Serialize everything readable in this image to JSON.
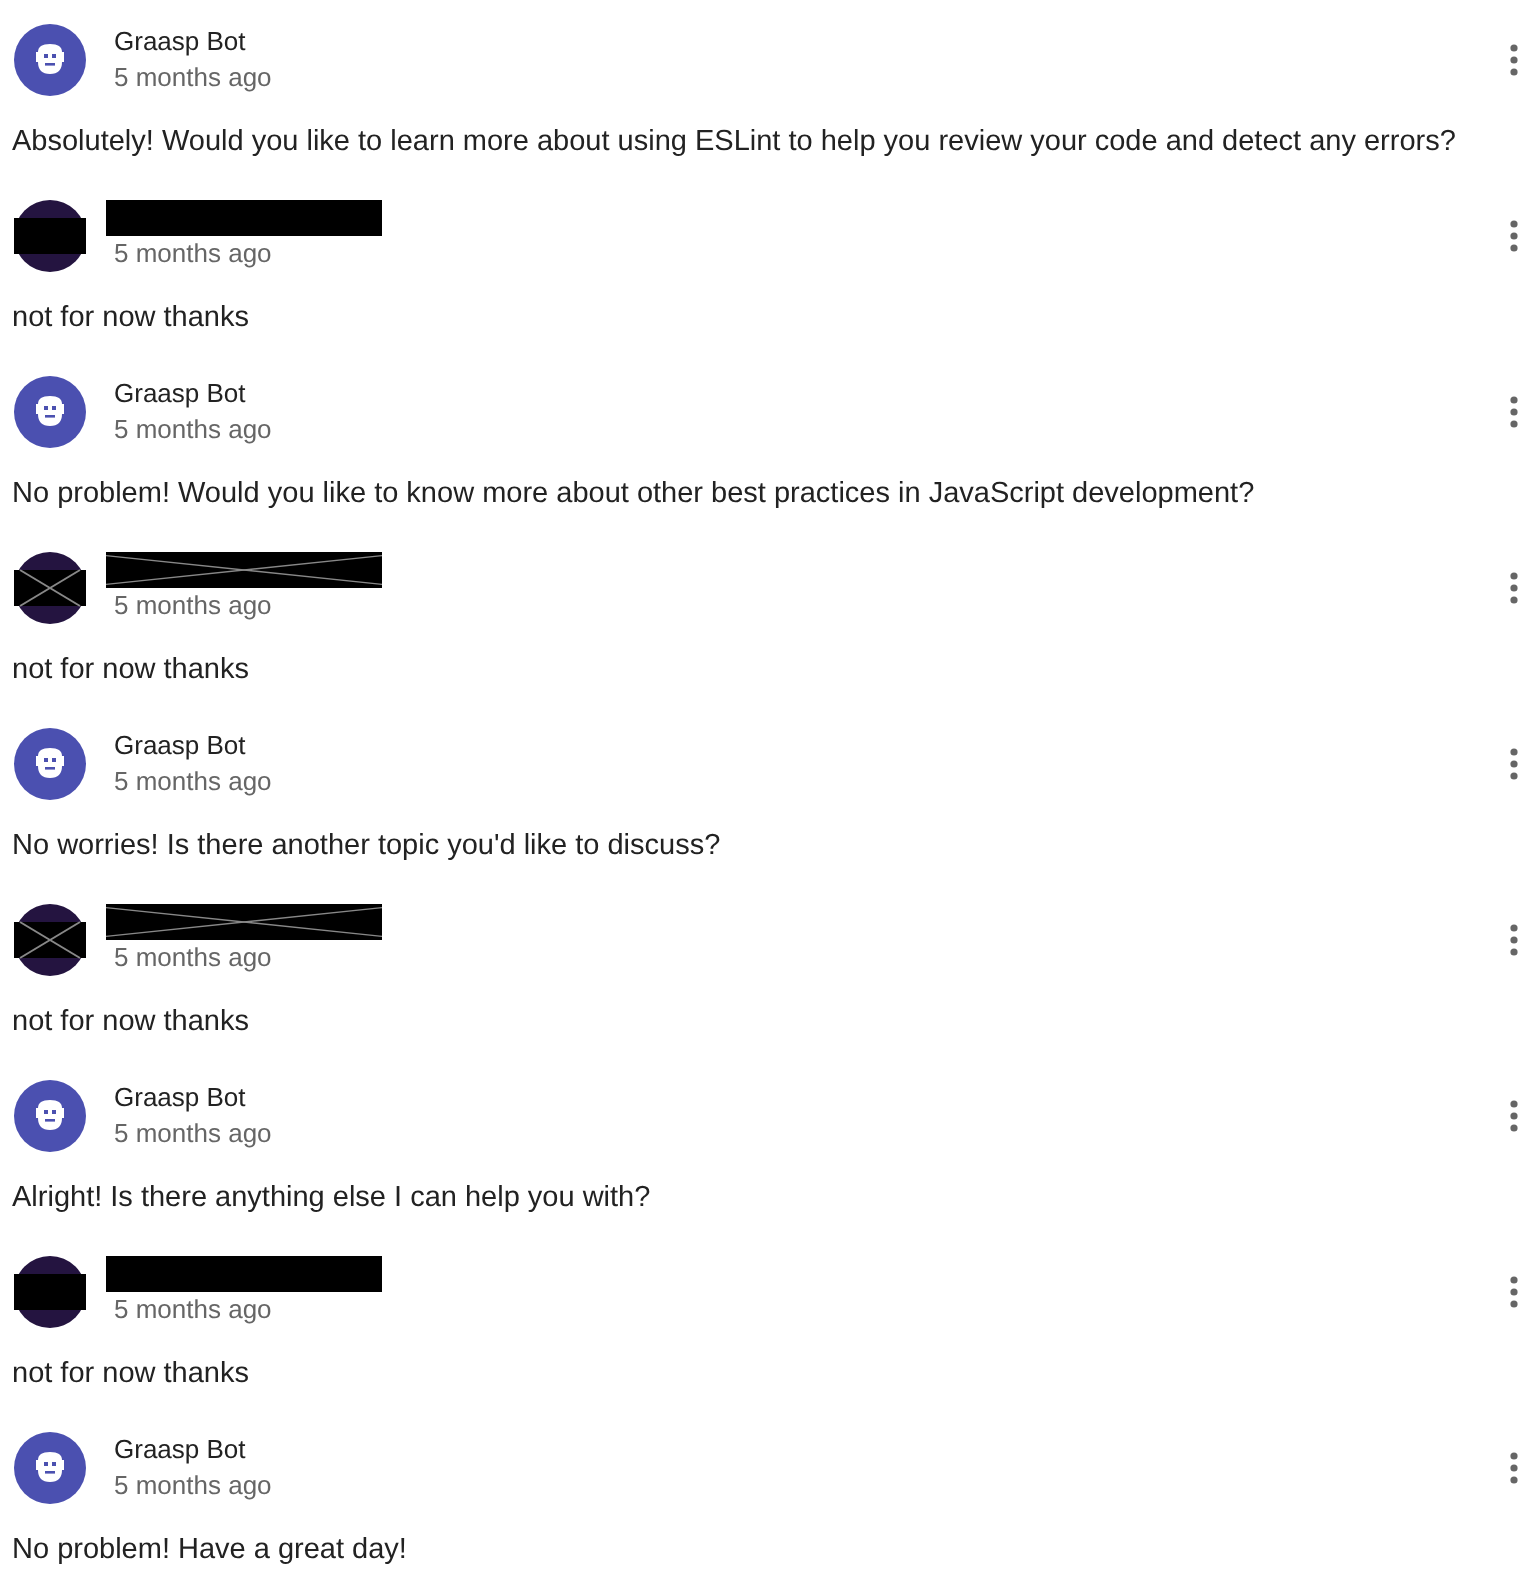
{
  "messages": [
    {
      "kind": "bot",
      "author": "Graasp Bot",
      "time": "5 months ago",
      "text": "Absolutely! Would you like to learn more about using ESLint to help you review your code and detect any errors?"
    },
    {
      "kind": "user",
      "crossed": false,
      "time": "5 months ago",
      "text": "not for now thanks"
    },
    {
      "kind": "bot",
      "author": "Graasp Bot",
      "time": "5 months ago",
      "text": "No problem! Would you like to know more about other best practices in JavaScript development?"
    },
    {
      "kind": "user",
      "crossed": true,
      "time": "5 months ago",
      "text": "not for now thanks"
    },
    {
      "kind": "bot",
      "author": "Graasp Bot",
      "time": "5 months ago",
      "text": "No worries! Is there another topic you'd like to discuss?"
    },
    {
      "kind": "user",
      "crossed": true,
      "time": "5 months ago",
      "text": "not for now thanks"
    },
    {
      "kind": "bot",
      "author": "Graasp Bot",
      "time": "5 months ago",
      "text": "Alright! Is there anything else I can help you with?"
    },
    {
      "kind": "user",
      "crossed": false,
      "time": "5 months ago",
      "text": "not for now thanks"
    },
    {
      "kind": "bot",
      "author": "Graasp Bot",
      "time": "5 months ago",
      "text": "No problem! Have a great day!"
    }
  ]
}
